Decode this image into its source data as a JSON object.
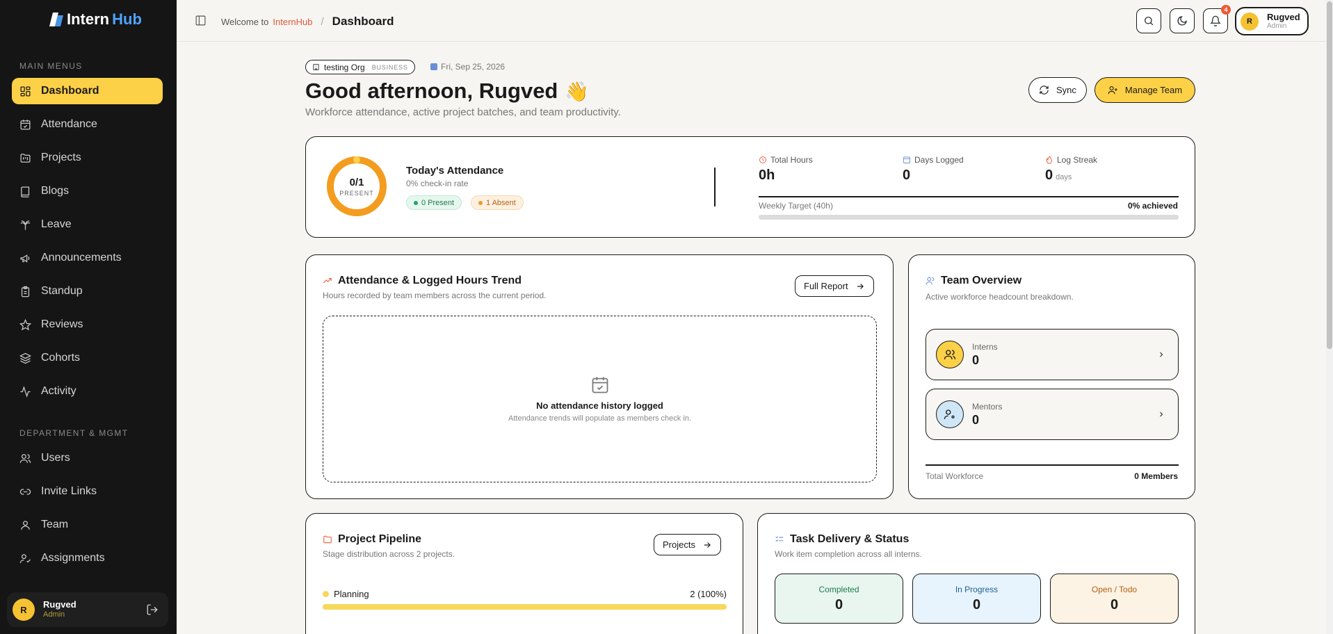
{
  "colors": {
    "accent": "#fdd147",
    "sidebar_bg": "#151515",
    "brand_orange": "#e05a3a",
    "brand_blue": "#4ea3ff"
  },
  "logo": {
    "word1": "Intern",
    "word2": "Hub"
  },
  "sidebar": {
    "main_title": "MAIN MENUS",
    "main_items": [
      {
        "label": "Dashboard",
        "icon": "grid-icon",
        "active": true
      },
      {
        "label": "Attendance",
        "icon": "calendar-check-icon"
      },
      {
        "label": "Projects",
        "icon": "folder-kanban-icon"
      },
      {
        "label": "Blogs",
        "icon": "book-icon"
      },
      {
        "label": "Leave",
        "icon": "palm-tree-icon"
      },
      {
        "label": "Announcements",
        "icon": "megaphone-icon"
      },
      {
        "label": "Standup",
        "icon": "clipboard-icon"
      },
      {
        "label": "Reviews",
        "icon": "star-icon"
      },
      {
        "label": "Cohorts",
        "icon": "layers-icon"
      },
      {
        "label": "Activity",
        "icon": "activity-icon"
      }
    ],
    "dept_title": "DEPARTMENT & MGMT",
    "dept_items": [
      {
        "label": "Users",
        "icon": "users-icon"
      },
      {
        "label": "Invite Links",
        "icon": "link-icon"
      },
      {
        "label": "Team",
        "icon": "user-icon"
      },
      {
        "label": "Assignments",
        "icon": "user-check-icon"
      }
    ],
    "user": {
      "initial": "R",
      "name": "Rugved",
      "role": "Admin"
    }
  },
  "topbar": {
    "welcome": "Welcome to",
    "brand": "InternHub",
    "separator": "/",
    "current": "Dashboard",
    "notif_count": "4",
    "user": {
      "initial": "R",
      "name": "Rugved",
      "role": "Admin"
    }
  },
  "hero": {
    "org_name": "testing Org",
    "org_type": "BUSINESS",
    "date": "Fri, Sep 25, 2026",
    "greeting": "Good afternoon, Rugved",
    "wave": "👋",
    "subtitle": "Workforce attendance, active project batches, and team productivity.",
    "sync_label": "Sync",
    "manage_label": "Manage Team"
  },
  "attendance": {
    "ring_value": "0/1",
    "ring_label": "PRESENT",
    "ring_fraction": 0,
    "title": "Today's Attendance",
    "rate": "0% check-in rate",
    "present": "0 Present",
    "absent": "1 Absent",
    "total_hours_label": "Total Hours",
    "total_hours": "0h",
    "days_logged_label": "Days Logged",
    "days_logged": "0",
    "streak_label": "Log Streak",
    "streak": "0",
    "streak_unit": "days",
    "target_label": "Weekly Target (40h)",
    "target_pct": "0% achieved",
    "target_fraction": 0
  },
  "trend": {
    "title": "Attendance & Logged Hours Trend",
    "subtitle": "Hours recorded by team members across the current period.",
    "button": "Full Report",
    "empty_title": "No attendance history logged",
    "empty_sub": "Attendance trends will populate as members check in."
  },
  "team": {
    "title": "Team Overview",
    "subtitle": "Active workforce headcount breakdown.",
    "interns_label": "Interns",
    "interns_value": "0",
    "mentors_label": "Mentors",
    "mentors_value": "0",
    "total_label": "Total Workforce",
    "total_value": "0 Members"
  },
  "pipeline": {
    "title": "Project Pipeline",
    "subtitle": "Stage distribution across 2 projects.",
    "button": "Projects",
    "stage_name": "Planning",
    "stage_value": "2 (100%)",
    "stage_fraction": 1
  },
  "tasks": {
    "title": "Task Delivery & Status",
    "subtitle": "Work item completion across all interns.",
    "items": [
      {
        "label": "Completed",
        "value": "0",
        "bg": "#e8f6ef",
        "fg": "#1f7a4d"
      },
      {
        "label": "In Progress",
        "value": "0",
        "bg": "#e7f3fd",
        "fg": "#1d5f94"
      },
      {
        "label": "Open / Todo",
        "value": "0",
        "bg": "#fdf3e4",
        "fg": "#b45d0f"
      }
    ]
  }
}
